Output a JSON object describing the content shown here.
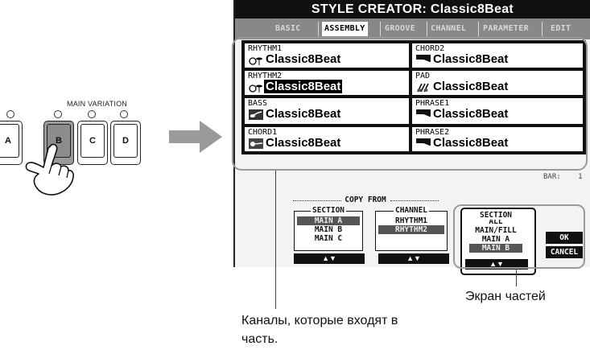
{
  "panel": {
    "main_variation_label": "MAIN VARIATION",
    "buttons": [
      {
        "label": "A",
        "pressed": false
      },
      {
        "label": "B",
        "pressed": true
      },
      {
        "label": "C",
        "pressed": false
      },
      {
        "label": "D",
        "pressed": false
      }
    ]
  },
  "screen": {
    "title": "STYLE CREATOR: Classic8Beat",
    "tabs": [
      {
        "label": "BASIC",
        "active": false
      },
      {
        "label": "ASSEMBLY",
        "active": true
      },
      {
        "label": "GROOVE",
        "active": false
      },
      {
        "label": "CHANNEL",
        "active": false
      },
      {
        "label": "PARAMETER",
        "active": false
      },
      {
        "label": "EDIT",
        "active": false
      }
    ],
    "channels": [
      {
        "label": "RHYTHM1",
        "value": "Classic8Beat",
        "icon": "drum-kit-icon",
        "selected": false
      },
      {
        "label": "CHORD2",
        "value": "Classic8Beat",
        "icon": "piano-icon",
        "selected": false
      },
      {
        "label": "RHYTHM2",
        "value": "Classic8Beat",
        "icon": "drum-kit-icon",
        "selected": true
      },
      {
        "label": "PAD",
        "value": "Classic8Beat",
        "icon": "strings-icon",
        "selected": false
      },
      {
        "label": "BASS",
        "value": "Classic8Beat",
        "icon": "bass-guitar-icon",
        "selected": false
      },
      {
        "label": "PHRASE1",
        "value": "Classic8Beat",
        "icon": "piano-icon",
        "selected": false
      },
      {
        "label": "CHORD1",
        "value": "Classic8Beat",
        "icon": "guitar-icon",
        "selected": false
      },
      {
        "label": "PHRASE2",
        "value": "Classic8Beat",
        "icon": "piano-icon",
        "selected": false
      }
    ],
    "bar_label": "BAR:",
    "bar_value": "1",
    "copy_from": "COPY FROM",
    "copy_section": {
      "title": "SECTION",
      "items": [
        {
          "label": "MAIN A",
          "selected": true
        },
        {
          "label": "MAIN B",
          "selected": false
        },
        {
          "label": "MAIN C",
          "selected": false
        }
      ]
    },
    "copy_channel": {
      "title": "CHANNEL",
      "items": [
        {
          "label": "RHYTHM1",
          "selected": false
        },
        {
          "label": "RHYTHM2",
          "selected": true
        }
      ]
    },
    "target_section": {
      "title": "SECTION",
      "items": [
        {
          "label": "ALL",
          "selected": false
        },
        {
          "label": "MAIN/FILL",
          "selected": false
        },
        {
          "label": "MAIN A",
          "selected": false
        },
        {
          "label": "MAIN B",
          "selected": true
        }
      ]
    },
    "updown_label": "▲▼",
    "ok_label": "OK",
    "cancel_label": "CANCEL"
  },
  "captions": {
    "parts_screen": "Экран частей",
    "channels_line1": "Каналы, которые входят в",
    "channels_line2": "часть."
  },
  "colors": {
    "title_bar": "#111111",
    "tabs_bar": "#888888",
    "callout": "#9a9a9a",
    "arrow": "#9a9a9a"
  }
}
